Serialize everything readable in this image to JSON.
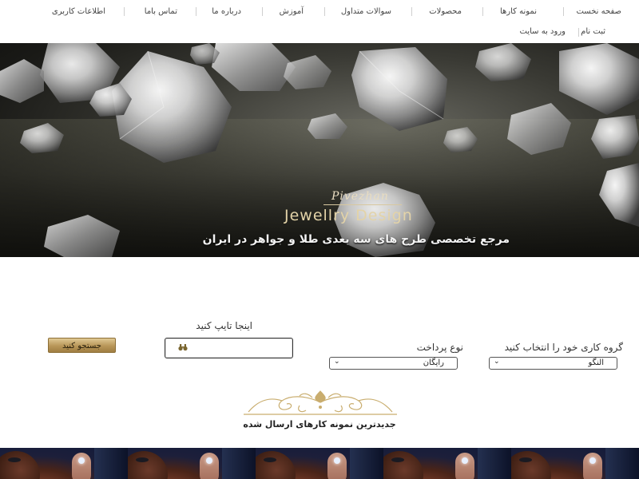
{
  "nav": {
    "items": [
      {
        "label": "صفحه نخست"
      },
      {
        "label": "نمونه کارها"
      },
      {
        "label": "محصولات"
      },
      {
        "label": "سوالات متداول"
      },
      {
        "label": "آموزش"
      },
      {
        "label": "درباره ما"
      },
      {
        "label": "تماس باما"
      },
      {
        "label": "اطلاعات کاربری"
      }
    ],
    "register": "ثبت نام",
    "login": "ورود به سایت"
  },
  "hero": {
    "script_text": "Pivezhan",
    "brand": "Jewellry Design",
    "tagline": "مرجع تخصصی طرح های سه بعدی طلا و جواهر در ایران"
  },
  "form": {
    "group_label": "گروه کاری خود را انتخاب کنید",
    "group_value": "النگو",
    "payment_label": "نوع پرداخت",
    "payment_value": "رایگان",
    "search_label": "اینجا تایپ کنید",
    "search_value": "",
    "search_button": "جستجو کنید"
  },
  "latest": {
    "title": "جدیدترین نمونه کارهای ارسال شده"
  },
  "colors": {
    "gold": "#b89658",
    "strip_bg": "#0d1730"
  },
  "icons": {
    "search_field": "binoculars-icon",
    "select": "chevron-down-icon"
  }
}
